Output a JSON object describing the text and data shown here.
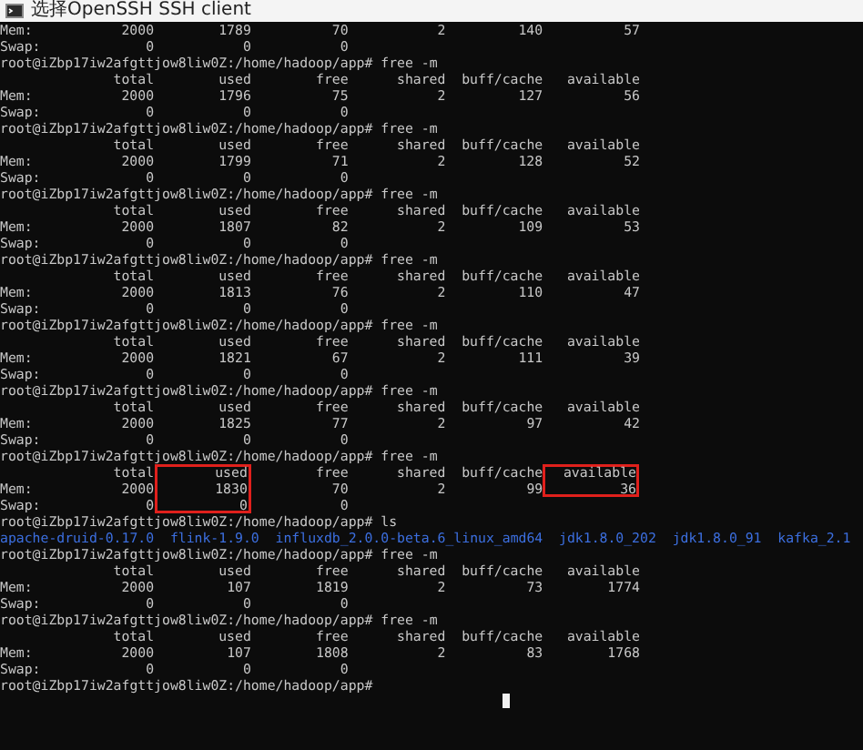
{
  "window": {
    "title": "选择OpenSSH SSH client"
  },
  "terminal": {
    "lines": [
      {
        "kind": "table",
        "label": "Mem:",
        "values": [
          "2000",
          "1789",
          "70",
          "2",
          "140",
          "57"
        ]
      },
      {
        "kind": "table",
        "label": "Swap:",
        "values": [
          "0",
          "0",
          "0"
        ]
      },
      {
        "kind": "prompt",
        "text": "root@iZbp17iw2afgttjow8liw0Z:/home/hadoop/app# free -m"
      },
      {
        "kind": "table",
        "values": [
          "total",
          "used",
          "free",
          "shared",
          "buff/cache",
          "available"
        ]
      },
      {
        "kind": "table",
        "label": "Mem:",
        "values": [
          "2000",
          "1796",
          "75",
          "2",
          "127",
          "56"
        ]
      },
      {
        "kind": "table",
        "label": "Swap:",
        "values": [
          "0",
          "0",
          "0"
        ]
      },
      {
        "kind": "prompt",
        "text": "root@iZbp17iw2afgttjow8liw0Z:/home/hadoop/app# free -m"
      },
      {
        "kind": "table",
        "values": [
          "total",
          "used",
          "free",
          "shared",
          "buff/cache",
          "available"
        ]
      },
      {
        "kind": "table",
        "label": "Mem:",
        "values": [
          "2000",
          "1799",
          "71",
          "2",
          "128",
          "52"
        ]
      },
      {
        "kind": "table",
        "label": "Swap:",
        "values": [
          "0",
          "0",
          "0"
        ]
      },
      {
        "kind": "prompt",
        "text": "root@iZbp17iw2afgttjow8liw0Z:/home/hadoop/app# free -m"
      },
      {
        "kind": "table",
        "values": [
          "total",
          "used",
          "free",
          "shared",
          "buff/cache",
          "available"
        ]
      },
      {
        "kind": "table",
        "label": "Mem:",
        "values": [
          "2000",
          "1807",
          "82",
          "2",
          "109",
          "53"
        ]
      },
      {
        "kind": "table",
        "label": "Swap:",
        "values": [
          "0",
          "0",
          "0"
        ]
      },
      {
        "kind": "prompt",
        "text": "root@iZbp17iw2afgttjow8liw0Z:/home/hadoop/app# free -m"
      },
      {
        "kind": "table",
        "values": [
          "total",
          "used",
          "free",
          "shared",
          "buff/cache",
          "available"
        ]
      },
      {
        "kind": "table",
        "label": "Mem:",
        "values": [
          "2000",
          "1813",
          "76",
          "2",
          "110",
          "47"
        ]
      },
      {
        "kind": "table",
        "label": "Swap:",
        "values": [
          "0",
          "0",
          "0"
        ]
      },
      {
        "kind": "prompt",
        "text": "root@iZbp17iw2afgttjow8liw0Z:/home/hadoop/app# free -m"
      },
      {
        "kind": "table",
        "values": [
          "total",
          "used",
          "free",
          "shared",
          "buff/cache",
          "available"
        ]
      },
      {
        "kind": "table",
        "label": "Mem:",
        "values": [
          "2000",
          "1821",
          "67",
          "2",
          "111",
          "39"
        ]
      },
      {
        "kind": "table",
        "label": "Swap:",
        "values": [
          "0",
          "0",
          "0"
        ]
      },
      {
        "kind": "prompt",
        "text": "root@iZbp17iw2afgttjow8liw0Z:/home/hadoop/app# free -m"
      },
      {
        "kind": "table",
        "values": [
          "total",
          "used",
          "free",
          "shared",
          "buff/cache",
          "available"
        ]
      },
      {
        "kind": "table",
        "label": "Mem:",
        "values": [
          "2000",
          "1825",
          "77",
          "2",
          "97",
          "42"
        ]
      },
      {
        "kind": "table",
        "label": "Swap:",
        "values": [
          "0",
          "0",
          "0"
        ]
      },
      {
        "kind": "prompt",
        "text": "root@iZbp17iw2afgttjow8liw0Z:/home/hadoop/app# free -m"
      },
      {
        "kind": "table",
        "values": [
          "total",
          "used",
          "free",
          "shared",
          "buff/cache",
          "available"
        ],
        "boxed": [
          false,
          true,
          false,
          false,
          false,
          true
        ]
      },
      {
        "kind": "table",
        "label": "Mem:",
        "values": [
          "2000",
          "1830",
          "70",
          "2",
          "99",
          "36"
        ],
        "boxed": [
          false,
          true,
          false,
          false,
          false,
          true
        ]
      },
      {
        "kind": "table",
        "label": "Swap:",
        "values": [
          "0",
          "0",
          "0"
        ],
        "boxed": [
          false,
          true,
          false
        ]
      },
      {
        "kind": "prompt",
        "text": "root@iZbp17iw2afgttjow8liw0Z:/home/hadoop/app# ls"
      },
      {
        "kind": "listing",
        "entries": [
          "apache-druid-0.17.0",
          "flink-1.9.0",
          "influxdb_2.0.0-beta.6_linux_amd64",
          "jdk1.8.0_202",
          "jdk1.8.0_91",
          "kafka_2.1"
        ]
      },
      {
        "kind": "prompt",
        "text": "root@iZbp17iw2afgttjow8liw0Z:/home/hadoop/app# free -m"
      },
      {
        "kind": "table",
        "values": [
          "total",
          "used",
          "free",
          "shared",
          "buff/cache",
          "available"
        ]
      },
      {
        "kind": "table",
        "label": "Mem:",
        "values": [
          "2000",
          "107",
          "1819",
          "2",
          "73",
          "1774"
        ]
      },
      {
        "kind": "table",
        "label": "Swap:",
        "values": [
          "0",
          "0",
          "0"
        ]
      },
      {
        "kind": "prompt",
        "text": "root@iZbp17iw2afgttjow8liw0Z:/home/hadoop/app# free -m"
      },
      {
        "kind": "table",
        "values": [
          "total",
          "used",
          "free",
          "shared",
          "buff/cache",
          "available"
        ]
      },
      {
        "kind": "table",
        "label": "Mem:",
        "values": [
          "2000",
          "107",
          "1808",
          "2",
          "83",
          "1768"
        ]
      },
      {
        "kind": "table",
        "label": "Swap:",
        "values": [
          "0",
          "0",
          "0"
        ]
      },
      {
        "kind": "prompt",
        "text": "root@iZbp17iw2afgttjow8liw0Z:/home/hadoop/app#"
      }
    ]
  }
}
